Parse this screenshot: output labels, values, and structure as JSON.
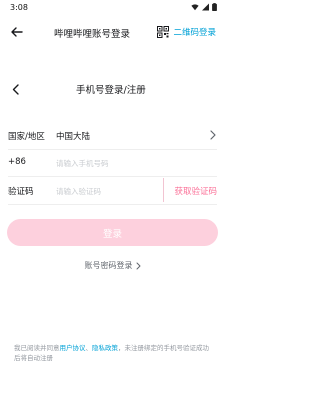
{
  "status_bar": {
    "time": "3:08"
  },
  "top_bar": {
    "title": "哔哩哔哩账号登录",
    "qr_login_label": "二维码登录"
  },
  "form": {
    "title": "手机号登录/注册",
    "country_label": "国家/地区",
    "country_value": "中国大陆",
    "phone_prefix": "+86",
    "phone_placeholder": "请输入手机号码",
    "code_label": "验证码",
    "code_placeholder": "请输入验证码",
    "get_code_label": "获取验证码",
    "login_button": "登录",
    "password_login_label": "账号密码登录"
  },
  "agreement": {
    "prefix": "我已阅读并同意",
    "user_agreement": "用户协议",
    "separator": "、",
    "privacy_policy": "隐私政策",
    "suffix": "，未注册绑定的手机号验证成功后将自动注册"
  },
  "colors": {
    "accent_pink": "#fb7299",
    "button_disabled_pink": "#fdd0dd",
    "link_blue": "#00a1d6"
  },
  "icons": [
    "wifi-icon",
    "signal-icon",
    "battery-icon",
    "back-arrow-icon",
    "qr-code-icon",
    "chevron-left-icon",
    "chevron-right-icon"
  ]
}
